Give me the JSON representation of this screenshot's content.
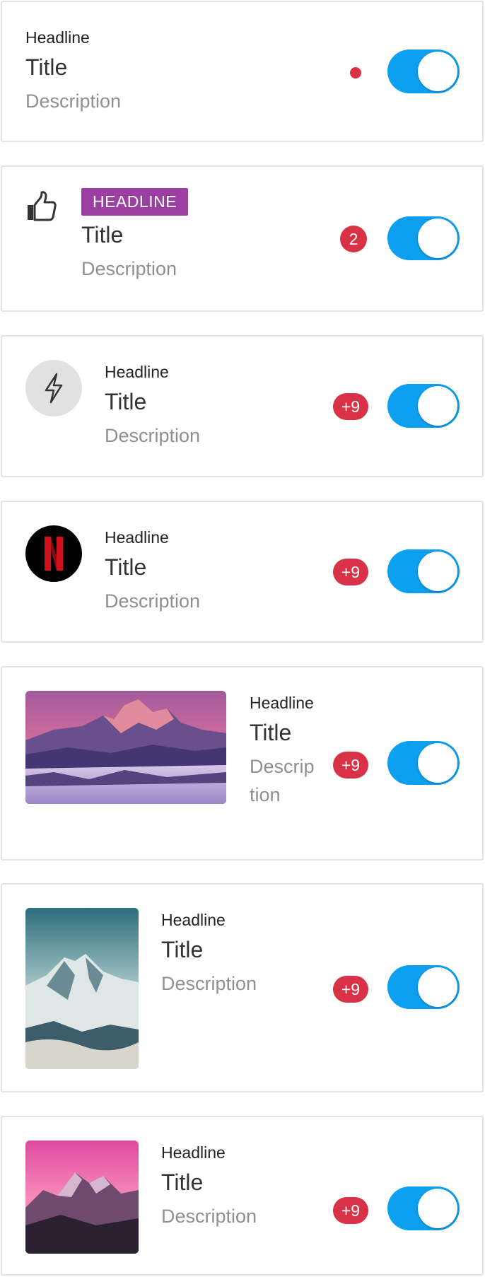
{
  "items": [
    {
      "headline": "Headline",
      "title": "Title",
      "description": "Description",
      "indicator": "dot",
      "toggle_on": true
    },
    {
      "headline": "HEADLINE",
      "title": "Title",
      "description": "Description",
      "icon": "thumbs-up-icon",
      "badge": "2",
      "toggle_on": true
    },
    {
      "headline": "Headline",
      "title": "Title",
      "description": "Description",
      "icon": "lightning-bolt-icon",
      "badge": "+9",
      "toggle_on": true
    },
    {
      "headline": "Headline",
      "title": "Title",
      "description": "Description",
      "icon": "netflix-logo",
      "badge": "+9",
      "toggle_on": true
    },
    {
      "headline": "Headline",
      "title": "Title",
      "description": "Description",
      "image": "mountain-landscape-image",
      "badge": "+9",
      "toggle_on": true
    },
    {
      "headline": "Headline",
      "title": "Title",
      "description": "Description",
      "image": "snowy-mountain-portrait-image",
      "badge": "+9",
      "toggle_on": true
    },
    {
      "headline": "Headline",
      "title": "Title",
      "description": "Description",
      "image": "pink-sky-mountain-image",
      "badge": "+9",
      "toggle_on": true
    }
  ],
  "colors": {
    "toggle_on": "#0ea0f0",
    "badge": "#d93247",
    "chip": "#9c3fa3",
    "border": "#e3e3e3"
  }
}
